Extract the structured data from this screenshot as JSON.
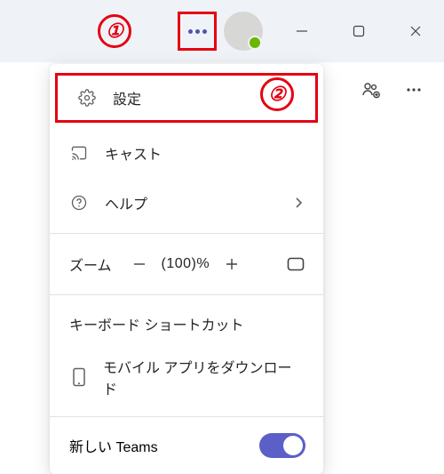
{
  "menu": {
    "settings": "設定",
    "cast": "キャスト",
    "help": "ヘルプ",
    "zoom_label": "ズーム",
    "zoom_value": "(100)%",
    "shortcuts": "キーボード ショートカット",
    "mobile": "モバイル アプリをダウンロード",
    "new_teams": "新しい Teams"
  },
  "callout": {
    "one": "①",
    "two": "②"
  }
}
